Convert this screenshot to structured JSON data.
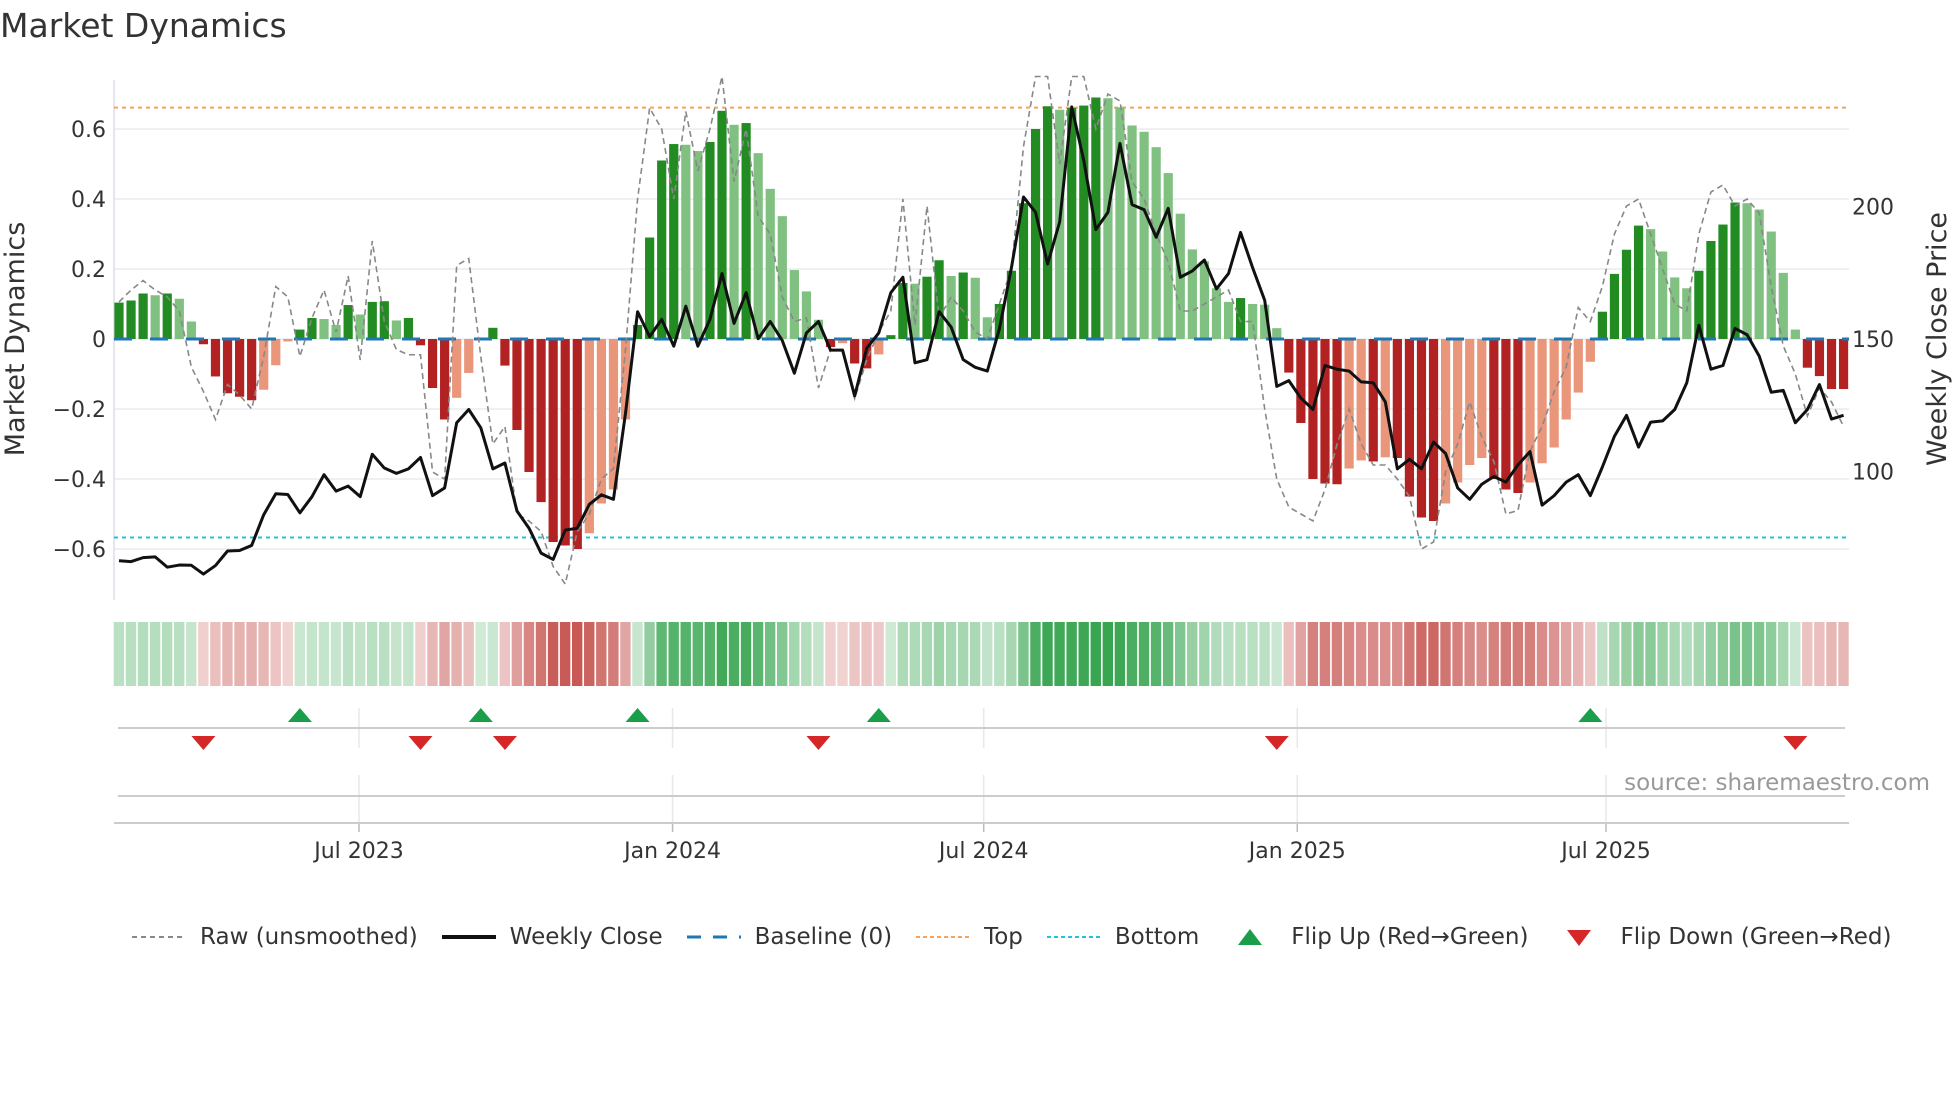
{
  "title": "Market Dynamics",
  "source": "source: sharemaestro.com",
  "colors": {
    "up_strong": "#228b22",
    "up_weak": "#80c080",
    "down_strong": "#b22222",
    "down_weak": "#e9967a",
    "raw": "#888888",
    "close": "#111111",
    "baseline": "#1f77b4",
    "top": "#f4a460",
    "bottom": "#22c3d8",
    "flip_up": "#1a9e4a",
    "flip_down": "#d62728"
  },
  "legend": [
    {
      "key": "raw",
      "label": "Raw (unsmoothed)"
    },
    {
      "key": "close",
      "label": "Weekly Close"
    },
    {
      "key": "baseline",
      "label": "Baseline (0)"
    },
    {
      "key": "top",
      "label": "Top"
    },
    {
      "key": "bottom",
      "label": "Bottom"
    },
    {
      "key": "flip_up",
      "label": "Flip Up (Red→Green)"
    },
    {
      "key": "flip_down",
      "label": "Flip Down (Green→Red)"
    }
  ],
  "chart_data": {
    "type": "bar",
    "title": "Market Dynamics",
    "xlabel": "",
    "ylabel": "Market Dynamics",
    "y2label": "Weekly Close Price",
    "ylim": [
      -0.74,
      0.74
    ],
    "y2lim": [
      62,
      239
    ],
    "yticks": [
      {
        "v": 0.6,
        "label": "0.6"
      },
      {
        "v": 0.4,
        "label": "0.4"
      },
      {
        "v": 0.2,
        "label": "0.2"
      },
      {
        "v": 0,
        "label": "0"
      },
      {
        "v": -0.2,
        "label": "−0.2"
      },
      {
        "v": -0.4,
        "label": "−0.4"
      },
      {
        "v": -0.6,
        "label": "−0.6"
      }
    ],
    "y2ticks": [
      {
        "v": 200,
        "label": "200"
      },
      {
        "v": 150,
        "label": "150"
      },
      {
        "v": 100,
        "label": "100"
      }
    ],
    "xticks": [
      {
        "week": 19.9,
        "label": "Jul 2023"
      },
      {
        "week": 45.9,
        "label": "Jan 2024"
      },
      {
        "week": 71.7,
        "label": "Jul 2024"
      },
      {
        "week": 97.7,
        "label": "Jan 2025"
      },
      {
        "week": 123.3,
        "label": "Jul 2025"
      }
    ],
    "top_level": 0.661,
    "bottom_level": -0.567,
    "baseline": 0,
    "smoothed": [
      0.104,
      0.11,
      0.13,
      0.125,
      0.13,
      0.115,
      0.05,
      -0.015,
      -0.107,
      -0.155,
      -0.165,
      -0.175,
      -0.145,
      -0.075,
      -0.007,
      0.027,
      0.06,
      0.057,
      0.04,
      0.097,
      0.07,
      0.106,
      0.108,
      0.053,
      0.06,
      -0.018,
      -0.14,
      -0.23,
      -0.168,
      -0.097,
      0.003,
      0.032,
      -0.076,
      -0.26,
      -0.38,
      -0.466,
      -0.58,
      -0.59,
      -0.6,
      -0.555,
      -0.47,
      -0.43,
      -0.23,
      0.04,
      0.29,
      0.51,
      0.557,
      0.555,
      0.537,
      0.563,
      0.652,
      0.612,
      0.617,
      0.531,
      0.429,
      0.351,
      0.197,
      0.136,
      0.055,
      -0.023,
      -0.012,
      -0.07,
      -0.084,
      -0.044,
      0.011,
      0.16,
      0.158,
      0.178,
      0.225,
      0.18,
      0.19,
      0.175,
      0.062,
      0.1,
      0.195,
      0.388,
      0.6,
      0.665,
      0.655,
      0.66,
      0.667,
      0.69,
      0.688,
      0.662,
      0.61,
      0.592,
      0.548,
      0.474,
      0.358,
      0.256,
      0.222,
      0.145,
      0.106,
      0.117,
      0.1,
      0.098,
      0.031,
      -0.096,
      -0.24,
      -0.4,
      -0.413,
      -0.415,
      -0.37,
      -0.347,
      -0.35,
      -0.338,
      -0.34,
      -0.45,
      -0.51,
      -0.52,
      -0.47,
      -0.41,
      -0.36,
      -0.34,
      -0.4,
      -0.43,
      -0.44,
      -0.41,
      -0.355,
      -0.31,
      -0.23,
      -0.153,
      -0.065,
      0.078,
      0.186,
      0.255,
      0.324,
      0.314,
      0.25,
      0.176,
      0.145,
      0.195,
      0.28,
      0.327,
      0.39,
      0.388,
      0.37,
      0.307,
      0.189,
      0.027,
      -0.082,
      -0.106,
      -0.143,
      -0.143
    ],
    "raw": [
      0.106,
      0.14,
      0.167,
      0.14,
      0.12,
      0.08,
      -0.08,
      -0.15,
      -0.23,
      -0.13,
      -0.16,
      -0.2,
      -0.05,
      0.15,
      0.12,
      -0.05,
      0.06,
      0.14,
      0.02,
      0.18,
      -0.06,
      0.28,
      0.05,
      -0.03,
      -0.045,
      -0.045,
      -0.38,
      -0.4,
      0.21,
      0.23,
      -0.05,
      -0.3,
      -0.25,
      -0.5,
      -0.52,
      -0.55,
      -0.65,
      -0.7,
      -0.55,
      -0.5,
      -0.4,
      -0.37,
      -0.03,
      0.4,
      0.66,
      0.6,
      0.4,
      0.65,
      0.48,
      0.6,
      0.75,
      0.45,
      0.6,
      0.35,
      0.3,
      0.12,
      0.05,
      0.06,
      -0.14,
      -0.03,
      -0.03,
      -0.17,
      -0.06,
      0.02,
      0.08,
      0.4,
      0.04,
      0.38,
      0.06,
      0.12,
      0.08,
      0.02,
      0.0,
      0.1,
      0.2,
      0.55,
      0.75,
      0.75,
      0.5,
      0.75,
      0.75,
      0.6,
      0.7,
      0.68,
      0.45,
      0.4,
      0.3,
      0.22,
      0.08,
      0.08,
      0.1,
      0.12,
      0.14,
      0.05,
      0.05,
      -0.2,
      -0.4,
      -0.48,
      -0.5,
      -0.52,
      -0.43,
      -0.3,
      -0.2,
      -0.3,
      -0.36,
      -0.36,
      -0.4,
      -0.45,
      -0.6,
      -0.58,
      -0.38,
      -0.3,
      -0.18,
      -0.28,
      -0.35,
      -0.5,
      -0.49,
      -0.32,
      -0.25,
      -0.15,
      -0.08,
      0.09,
      0.05,
      0.15,
      0.3,
      0.38,
      0.4,
      0.3,
      0.2,
      0.1,
      0.08,
      0.3,
      0.42,
      0.44,
      0.38,
      0.4,
      0.36,
      0.15,
      -0.02,
      -0.1,
      -0.22,
      -0.14,
      -0.18,
      -0.25
    ],
    "close": [
      66.3,
      66.0,
      67.5,
      67.8,
      63.9,
      64.7,
      64.6,
      61.3,
      64.5,
      70.0,
      70.2,
      72.1,
      83.7,
      91.6,
      91.3,
      84.4,
      90.5,
      98.8,
      92.6,
      94.5,
      90.5,
      106.5,
      101.3,
      99.3,
      101.0,
      105.3,
      90.9,
      93.8,
      118.4,
      123.4,
      116.5,
      101.0,
      103.2,
      85.1,
      78.6,
      69.2,
      66.8,
      77.9,
      78.6,
      87.6,
      91.2,
      89.5,
      122.0,
      160.3,
      150.9,
      157.4,
      147.3,
      162.4,
      147.3,
      157.4,
      174.7,
      155.9,
      167.5,
      150.1,
      156.6,
      149.4,
      137.1,
      152.3,
      156.6,
      145.8,
      145.8,
      128.5,
      146.5,
      152.3,
      167.5,
      173.3,
      141.0,
      142.2,
      160.3,
      154.5,
      142.2,
      139.3,
      137.9,
      153.8,
      176.9,
      203.6,
      197.8,
      178.3,
      194.2,
      237.6,
      217.3,
      191.3,
      197.8,
      223.8,
      200.7,
      198.8,
      188.4,
      199.3,
      173.3,
      175.7,
      179.8,
      168.9,
      174.7,
      190.2,
      176.9,
      164.6,
      132.1,
      134.3,
      127.7,
      123.4,
      140.0,
      138.6,
      137.9,
      133.8,
      133.5,
      126.3,
      101.0,
      104.6,
      101.0,
      111.1,
      106.8,
      93.8,
      89.5,
      95.2,
      98.1,
      96.0,
      102.5,
      107.5,
      87.3,
      90.9,
      96.0,
      98.8,
      90.9,
      101.7,
      113.3,
      121.2,
      109.2,
      118.6,
      119.1,
      123.4,
      133.5,
      155.2,
      138.6,
      140.0,
      154.0,
      151.6,
      143.6,
      129.9,
      130.6,
      118.4,
      123.4,
      132.8,
      119.8,
      121.2
    ],
    "flip_up_weeks": [
      15,
      30,
      43,
      63,
      122
    ],
    "flip_down_weeks": [
      7,
      25,
      32,
      58,
      96,
      139
    ]
  }
}
